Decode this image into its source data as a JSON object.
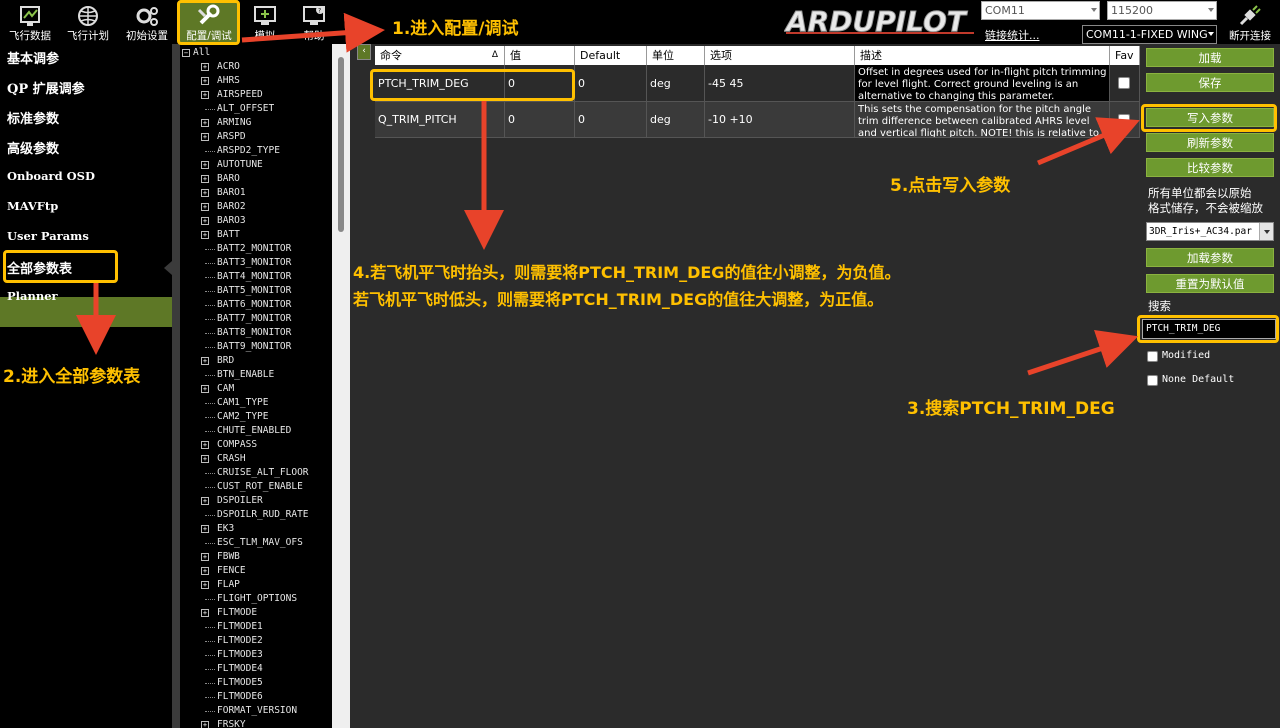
{
  "toolbar": {
    "flight_data": "飞行数据",
    "flight_plan": "飞行计划",
    "initial_setup": "初始设置",
    "config_tuning": "配置/调试",
    "simulation": "模拟",
    "help": "帮助",
    "logo": "ARDUPILOT",
    "port": "COM11",
    "baud": "115200",
    "link_stats": "链接统计...",
    "vehicle": "COM11-1-FIXED WING",
    "disconnect": "断开连接"
  },
  "left_menu": {
    "items": [
      "基本调参",
      "QP 扩展调参",
      "标准参数",
      "高级参数",
      "Onboard OSD",
      "MAVFtp",
      "User Params",
      "全部参数表",
      "Planner"
    ],
    "active_index": 7
  },
  "tree": {
    "rows": [
      {
        "label": "All",
        "expandable": true,
        "root": true
      },
      {
        "label": "ACRO",
        "expandable": true
      },
      {
        "label": "AHRS",
        "expandable": true
      },
      {
        "label": "AIRSPEED",
        "expandable": true
      },
      {
        "label": "ALT_OFFSET",
        "expandable": false
      },
      {
        "label": "ARMING",
        "expandable": true
      },
      {
        "label": "ARSPD",
        "expandable": true
      },
      {
        "label": "ARSPD2_TYPE",
        "expandable": false
      },
      {
        "label": "AUTOTUNE",
        "expandable": true
      },
      {
        "label": "BARO",
        "expandable": true
      },
      {
        "label": "BARO1",
        "expandable": true
      },
      {
        "label": "BARO2",
        "expandable": true
      },
      {
        "label": "BARO3",
        "expandable": true
      },
      {
        "label": "BATT",
        "expandable": true
      },
      {
        "label": "BATT2_MONITOR",
        "expandable": false
      },
      {
        "label": "BATT3_MONITOR",
        "expandable": false
      },
      {
        "label": "BATT4_MONITOR",
        "expandable": false
      },
      {
        "label": "BATT5_MONITOR",
        "expandable": false
      },
      {
        "label": "BATT6_MONITOR",
        "expandable": false
      },
      {
        "label": "BATT7_MONITOR",
        "expandable": false
      },
      {
        "label": "BATT8_MONITOR",
        "expandable": false
      },
      {
        "label": "BATT9_MONITOR",
        "expandable": false
      },
      {
        "label": "BRD",
        "expandable": true
      },
      {
        "label": "BTN_ENABLE",
        "expandable": false
      },
      {
        "label": "CAM",
        "expandable": true
      },
      {
        "label": "CAM1_TYPE",
        "expandable": false
      },
      {
        "label": "CAM2_TYPE",
        "expandable": false
      },
      {
        "label": "CHUTE_ENABLED",
        "expandable": false
      },
      {
        "label": "COMPASS",
        "expandable": true
      },
      {
        "label": "CRASH",
        "expandable": true
      },
      {
        "label": "CRUISE_ALT_FLOOR",
        "expandable": false
      },
      {
        "label": "CUST_ROT_ENABLE",
        "expandable": false
      },
      {
        "label": "DSPOILER",
        "expandable": true
      },
      {
        "label": "DSPOILR_RUD_RATE",
        "expandable": false
      },
      {
        "label": "EK3",
        "expandable": true
      },
      {
        "label": "ESC_TLM_MAV_OFS",
        "expandable": false
      },
      {
        "label": "FBWB",
        "expandable": true
      },
      {
        "label": "FENCE",
        "expandable": true
      },
      {
        "label": "FLAP",
        "expandable": true
      },
      {
        "label": "FLIGHT_OPTIONS",
        "expandable": false
      },
      {
        "label": "FLTMODE",
        "expandable": true
      },
      {
        "label": "FLTMODE1",
        "expandable": false
      },
      {
        "label": "FLTMODE2",
        "expandable": false
      },
      {
        "label": "FLTMODE3",
        "expandable": false
      },
      {
        "label": "FLTMODE4",
        "expandable": false
      },
      {
        "label": "FLTMODE5",
        "expandable": false
      },
      {
        "label": "FLTMODE6",
        "expandable": false
      },
      {
        "label": "FORMAT_VERSION",
        "expandable": false
      },
      {
        "label": "FRSKY",
        "expandable": true
      }
    ]
  },
  "table": {
    "headers": {
      "command": "命令",
      "sort": "Δ",
      "value": "值",
      "default": "Default",
      "unit": "单位",
      "options": "选项",
      "desc": "描述",
      "fav": "Fav"
    },
    "rows": [
      {
        "command": "PTCH_TRIM_DEG",
        "value": "0",
        "default": "0",
        "unit": "deg",
        "options": "-45 45",
        "desc": "Offset in degrees used for in-flight pitch trimming for level flight. Correct ground leveling is an alternative to changing this parameter."
      },
      {
        "command": "Q_TRIM_PITCH",
        "value": "0",
        "default": "0",
        "unit": "deg",
        "options": "-10 +10",
        "desc": "This sets the compensation for the pitch angle trim difference between calibrated AHRS level and vertical flight pitch. NOTE! this is relative to"
      }
    ]
  },
  "right_panel": {
    "load": "加载",
    "save": "保存",
    "write": "写入参数",
    "refresh": "刷新参数",
    "compare": "比较参数",
    "note_line1": "所有单位都会以原始",
    "note_line2": "格式储存，不会被缩放",
    "param_file": "3DR_Iris+_AC34.par",
    "load_params": "加载参数",
    "reset_default": "重置为默认值",
    "search_label": "搜索",
    "search_value": "PTCH_TRIM_DEG",
    "modified": "Modified",
    "none_default": "None Default"
  },
  "annotations": {
    "step1": "1.进入配置/调试",
    "step2": "2.进入全部参数表",
    "step3": "3.搜索PTCH_TRIM_DEG",
    "step4_line1": "4.若飞机平飞时抬头，则需要将PTCH_TRIM_DEG的值往小调整，为负值。",
    "step4_line2": "若飞机平飞时低头，则需要将PTCH_TRIM_DEG的值往大调整，为正值。",
    "step5": "5.点击写入参数",
    "color": "#ffc000",
    "arrow_color": "#e8432a"
  },
  "colors": {
    "accent_green": "#6e9a2f",
    "active_menu": "#5e7826"
  }
}
